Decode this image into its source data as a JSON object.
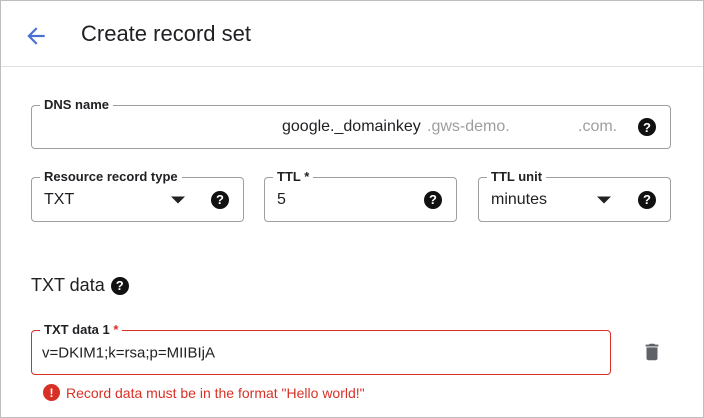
{
  "header": {
    "title": "Create record set"
  },
  "dns_name": {
    "label": "DNS name",
    "value": "google._domainkey",
    "suffix_left": ".gws-demo.",
    "suffix_right": ".com."
  },
  "record_type": {
    "label": "Resource record type",
    "value": "TXT"
  },
  "ttl": {
    "label": "TTL",
    "required_mark": "*",
    "value": "5"
  },
  "ttl_unit": {
    "label": "TTL unit",
    "value": "minutes"
  },
  "txt_section": {
    "title": "TXT data"
  },
  "txt_data_1": {
    "label": "TXT data 1",
    "required_mark": "*",
    "value": "v=DKIM1;k=rsa;p=MIIBIjA"
  },
  "error": {
    "message": "Record data must be in the format \"Hello world!\""
  },
  "icons": {
    "help": "?",
    "error": "!"
  },
  "colors": {
    "accent": "#4a6fd0",
    "error": "#d93025"
  }
}
